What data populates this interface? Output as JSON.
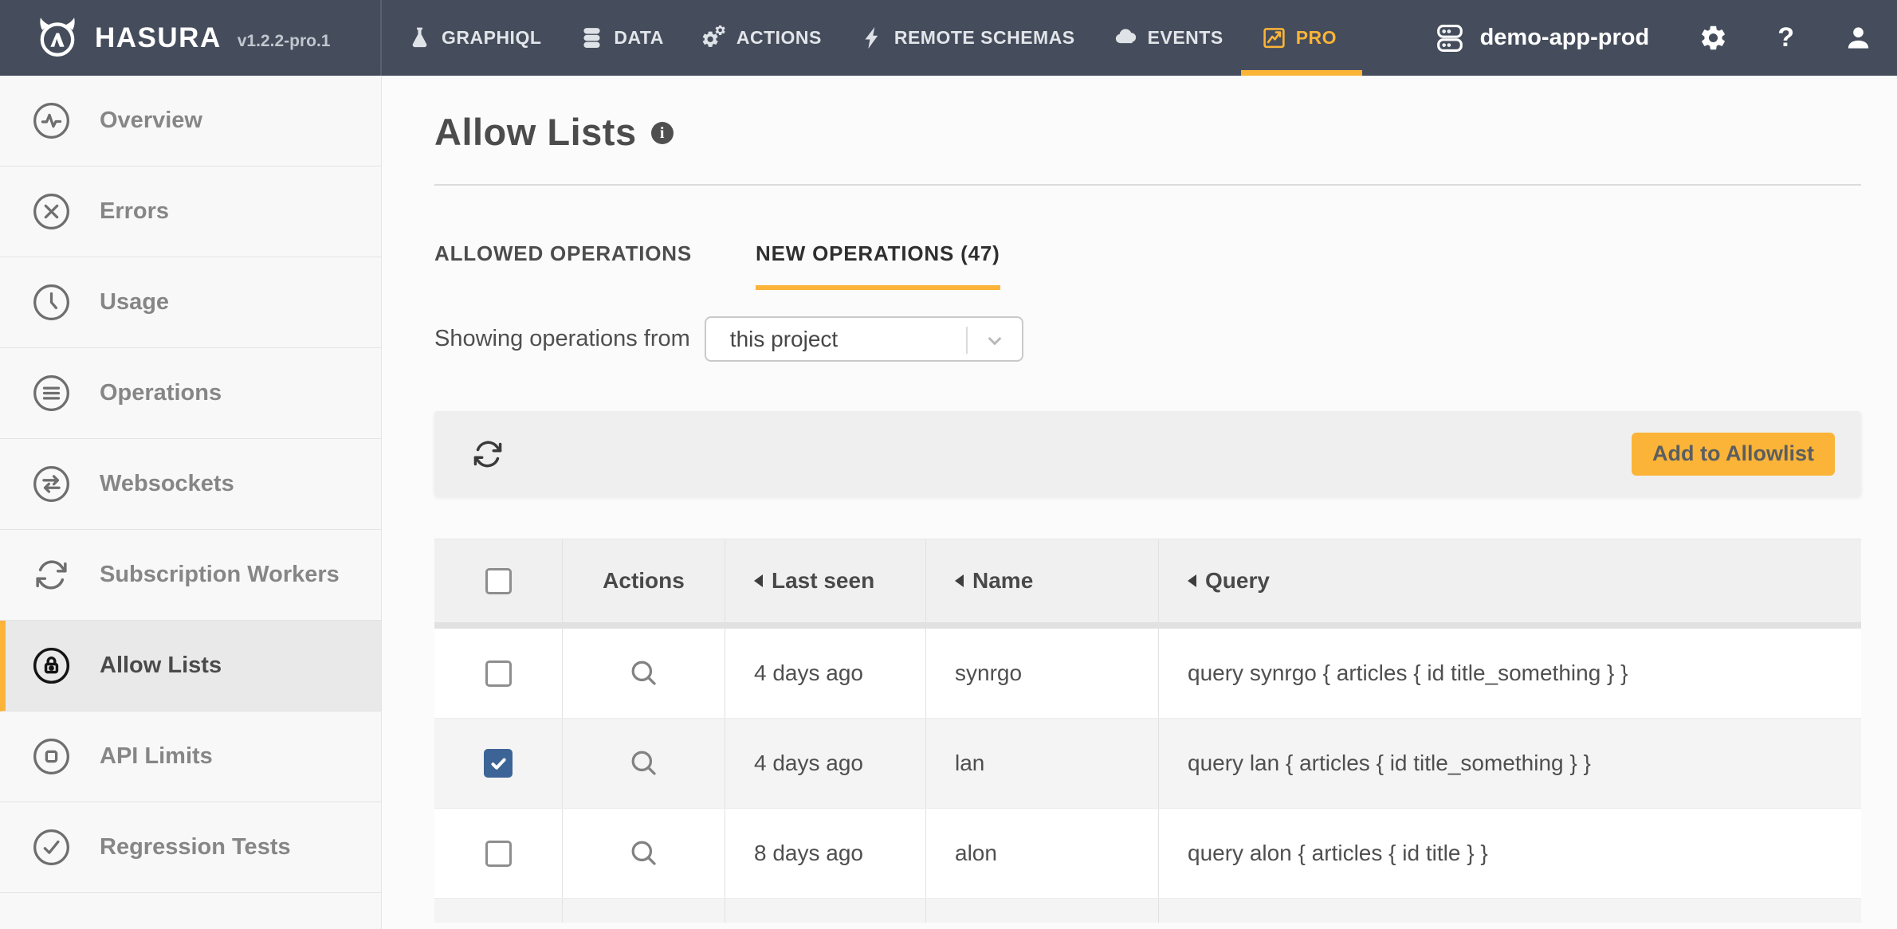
{
  "colors": {
    "accent": "#fbb437",
    "navbar_bg": "#454d5c",
    "checkbox_checked": "#3d6496"
  },
  "navbar": {
    "brand": "HASURA",
    "version": "v1.2.2-pro.1",
    "items": [
      {
        "label": "GRAPHIQL",
        "icon": "flask-icon",
        "active": false
      },
      {
        "label": "DATA",
        "icon": "database-icon",
        "active": false
      },
      {
        "label": "ACTIONS",
        "icon": "gears-icon",
        "active": false
      },
      {
        "label": "REMOTE SCHEMAS",
        "icon": "bolt-icon",
        "active": false
      },
      {
        "label": "EVENTS",
        "icon": "cloud-icon",
        "active": false
      },
      {
        "label": "PRO",
        "icon": "chart-icon",
        "active": true
      }
    ],
    "project": "demo-app-prod",
    "help": "?"
  },
  "sidebar": {
    "items": [
      {
        "label": "Overview",
        "icon": "pulse-icon",
        "active": false
      },
      {
        "label": "Errors",
        "icon": "error-icon",
        "active": false
      },
      {
        "label": "Usage",
        "icon": "clock-icon",
        "active": false
      },
      {
        "label": "Operations",
        "icon": "list-icon",
        "active": false
      },
      {
        "label": "Websockets",
        "icon": "arrows-icon",
        "active": false
      },
      {
        "label": "Subscription Workers",
        "icon": "sync-icon",
        "active": false
      },
      {
        "label": "Allow Lists",
        "icon": "lock-icon",
        "active": true
      },
      {
        "label": "API Limits",
        "icon": "square-icon",
        "active": false
      },
      {
        "label": "Regression Tests",
        "icon": "check-icon",
        "active": false
      }
    ]
  },
  "main": {
    "title": "Allow Lists",
    "tabs": [
      {
        "label": "ALLOWED OPERATIONS",
        "active": false
      },
      {
        "label": "NEW OPERATIONS (47)",
        "active": true
      }
    ],
    "filter": {
      "label": "Showing operations from",
      "selected": "this project"
    },
    "toolbar": {
      "add_button": "Add to Allowlist"
    },
    "table": {
      "columns": [
        {
          "label": "",
          "sortable": false
        },
        {
          "label": "Actions",
          "sortable": false
        },
        {
          "label": "Last seen",
          "sortable": true
        },
        {
          "label": "Name",
          "sortable": true
        },
        {
          "label": "Query",
          "sortable": true
        }
      ],
      "rows": [
        {
          "checked": false,
          "last_seen": "4 days ago",
          "name": "synrgo",
          "query": "query synrgo { articles { id title_something } }"
        },
        {
          "checked": true,
          "last_seen": "4 days ago",
          "name": "lan",
          "query": "query lan { articles { id title_something } }"
        },
        {
          "checked": false,
          "last_seen": "8 days ago",
          "name": "alon",
          "query": "query alon { articles { id title } }"
        }
      ]
    }
  }
}
